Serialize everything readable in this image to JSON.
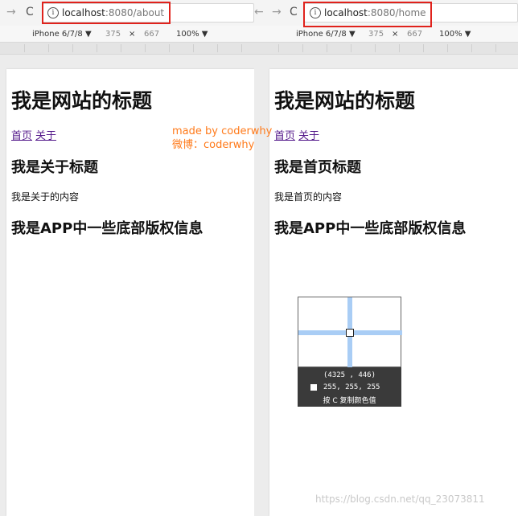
{
  "panes": {
    "left": {
      "url_host": "localhost",
      "url_path": ":8080/about",
      "device": "iPhone 6/7/8 ▼",
      "width": "375",
      "times": "×",
      "height": "667",
      "zoom": "100% ▼",
      "site_title": "我是网站的标题",
      "link_home": "首页",
      "link_about": "关于",
      "heading": "我是关于标题",
      "content": "我是关于的内容",
      "footer": "我是APP中一些底部版权信息"
    },
    "right": {
      "url_host": "localhost",
      "url_path": ":8080/home",
      "device": "iPhone 6/7/8 ▼",
      "width": "375",
      "times": "×",
      "height": "667",
      "zoom": "100% ▼",
      "site_title": "我是网站的标题",
      "link_home": "首页",
      "link_about": "关于",
      "heading": "我是首页标题",
      "content": "我是首页的内容",
      "footer": "我是APP中一些底部版权信息"
    }
  },
  "nav": {
    "forward": "→",
    "reload": "C",
    "back": "←",
    "info": "i"
  },
  "made_by": {
    "line1": "made by coderwhy",
    "line2": "微博：coderwhy"
  },
  "color_picker": {
    "coords": "(4325   ,  446)",
    "rgb": "255, 255, 255",
    "hint": "按 C 复制颜色值"
  },
  "watermark": "https://blog.csdn.net/qq_23073811",
  "colors": {
    "highlight": "#e0221c",
    "annotation": "#ff7a1a",
    "link": "#551a8b"
  }
}
